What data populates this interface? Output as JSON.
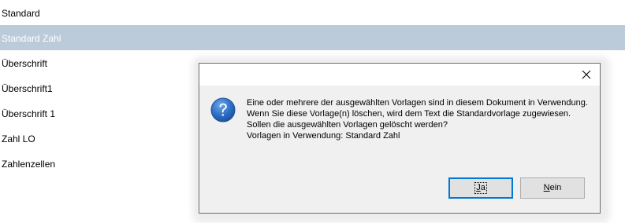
{
  "style_list": {
    "items": [
      {
        "label": "Standard",
        "selected": false
      },
      {
        "label": "Standard Zahl",
        "selected": true
      },
      {
        "label": "Überschrift",
        "selected": false
      },
      {
        "label": "Überschrift1",
        "selected": false
      },
      {
        "label": "Überschrift 1",
        "selected": false
      },
      {
        "label": "Zahl LO",
        "selected": false
      },
      {
        "label": "Zahlenzellen",
        "selected": false
      }
    ],
    "selected_color": "#bccbda"
  },
  "dialog": {
    "icon": "question-icon",
    "close_icon": "close-icon",
    "message": {
      "line1": "Eine oder mehrere der ausgewählten Vorlagen sind in diesem Dokument in Verwendung.",
      "line2": "Wenn Sie diese Vorlage(n) löschen, wird dem Text die Standardvorlage zugewiesen.",
      "line3": "Sollen die ausgewählten Vorlagen gelöscht werden?",
      "line4": "Vorlagen in Verwendung: Standard Zahl"
    },
    "buttons": {
      "yes": {
        "mnemonic": "J",
        "rest": "a"
      },
      "no": {
        "mnemonic": "N",
        "rest": "ein"
      }
    },
    "focus_color": "#0078d7"
  }
}
